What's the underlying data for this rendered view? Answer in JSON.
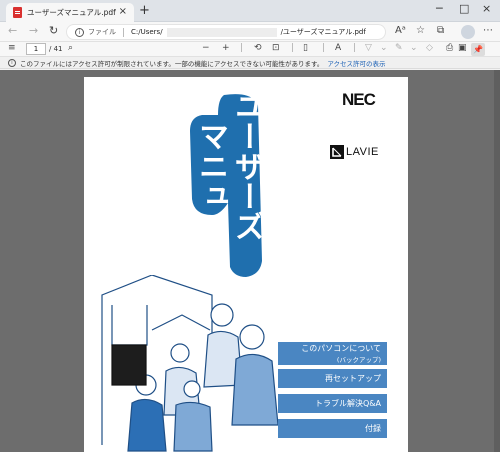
{
  "browser": {
    "tab_title": "ユーザーズマニュアル.pdf",
    "url_scheme": "ファイル",
    "url_prefix": "C:/Users/",
    "url_file": "/ユーザーズマニュアル.pdf"
  },
  "pdf_toolbar": {
    "page_current": "1",
    "page_total": "/ 41"
  },
  "infobar": {
    "message": "このファイルにはアクセス許可が制限されています。一部の機能にアクセスできない可能性があります。",
    "link": "アクセス許可の表示"
  },
  "document": {
    "brand": "NEC",
    "sub_brand": "LAVIE",
    "title_col1": "ユーザーズ",
    "title_col2": "マニュアル",
    "menu": [
      {
        "label": "このパソコンについて",
        "sub": "(バックアップ)"
      },
      {
        "label": "再セットアップ",
        "sub": ""
      },
      {
        "label": "トラブル解決Q&A",
        "sub": ""
      },
      {
        "label": "付録",
        "sub": ""
      }
    ]
  },
  "colors": {
    "title_blue": "#1f6fae",
    "menu_blue": "#4a86c2",
    "viewer_gray": "#6d6d6d"
  }
}
